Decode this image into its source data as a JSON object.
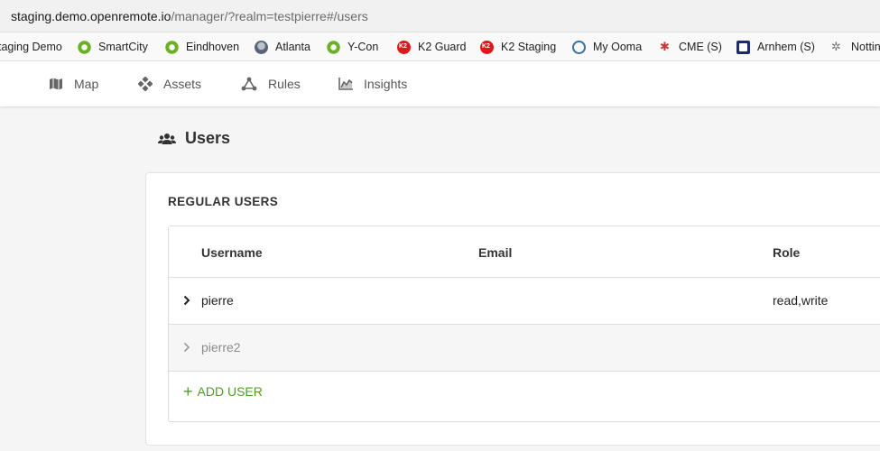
{
  "browser": {
    "url_host": "staging.demo.openremote.io",
    "url_path": "/manager/?realm=testpierre#/users"
  },
  "bookmarks": [
    {
      "label": "taging Demo",
      "icon": "none"
    },
    {
      "label": "SmartCity",
      "icon": "openremote-green-icon"
    },
    {
      "label": "Eindhoven",
      "icon": "openremote-green-icon"
    },
    {
      "label": "Atlanta",
      "icon": "atlanta-icon"
    },
    {
      "label": "Y-Con",
      "icon": "openremote-green-icon"
    },
    {
      "label": "K2 Guard",
      "icon": "k2-red-icon"
    },
    {
      "label": "K2 Staging",
      "icon": "k2-red-icon"
    },
    {
      "label": "My Ooma",
      "icon": "ooma-icon"
    },
    {
      "label": "CME (S)",
      "icon": "cme-icon"
    },
    {
      "label": "Arnhem (S)",
      "icon": "arnhem-icon"
    },
    {
      "label": "Nottin",
      "icon": "nottingham-icon"
    }
  ],
  "nav": {
    "map": "Map",
    "assets": "Assets",
    "rules": "Rules",
    "insights": "Insights"
  },
  "page": {
    "title": "Users"
  },
  "card": {
    "heading": "REGULAR USERS",
    "columns": [
      "Username",
      "Email",
      "Role"
    ],
    "rows": [
      {
        "username": "pierre",
        "email": "",
        "role": "read,write"
      },
      {
        "username": "pierre2",
        "email": "",
        "role": ""
      }
    ],
    "add_user": "ADD USER"
  },
  "colors": {
    "accent_green": "#4d9d2a",
    "k2_red": "#e3161c"
  }
}
